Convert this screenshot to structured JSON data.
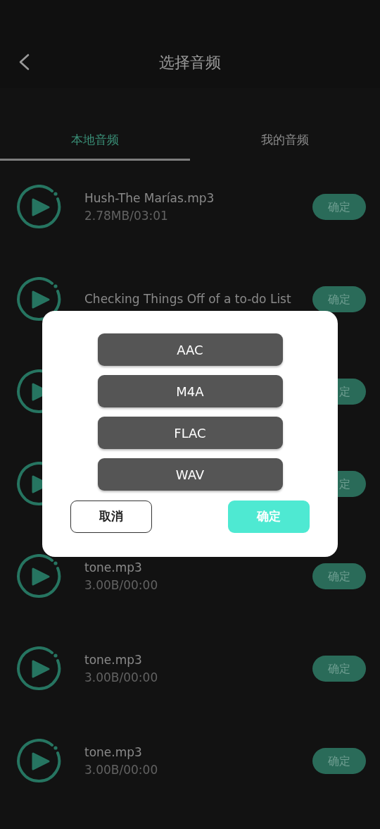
{
  "header": {
    "title": "选择音频"
  },
  "tabs": [
    {
      "label": "本地音频",
      "selected": true
    },
    {
      "label": "我的音频",
      "selected": false
    }
  ],
  "files": [
    {
      "title": "Hush-The Marías.mp3",
      "meta": "2.78MB/03:01",
      "button": "确定"
    },
    {
      "title": "Checking Things Off of a to-do List",
      "button": "确定"
    },
    {
      "button": "定"
    },
    {
      "button": "定"
    },
    {
      "title": "tone.mp3",
      "meta": "3.00B/00:00",
      "button": "确定"
    },
    {
      "title": "tone.mp3",
      "meta": "3.00B/00:00",
      "button": "确定"
    },
    {
      "title": "tone.mp3",
      "meta": "3.00B/00:00",
      "button": "确定"
    }
  ],
  "dialog": {
    "formats": [
      "AAC",
      "M4A",
      "FLAC",
      "WAV"
    ],
    "cancel": "取消",
    "confirm": "确定"
  }
}
